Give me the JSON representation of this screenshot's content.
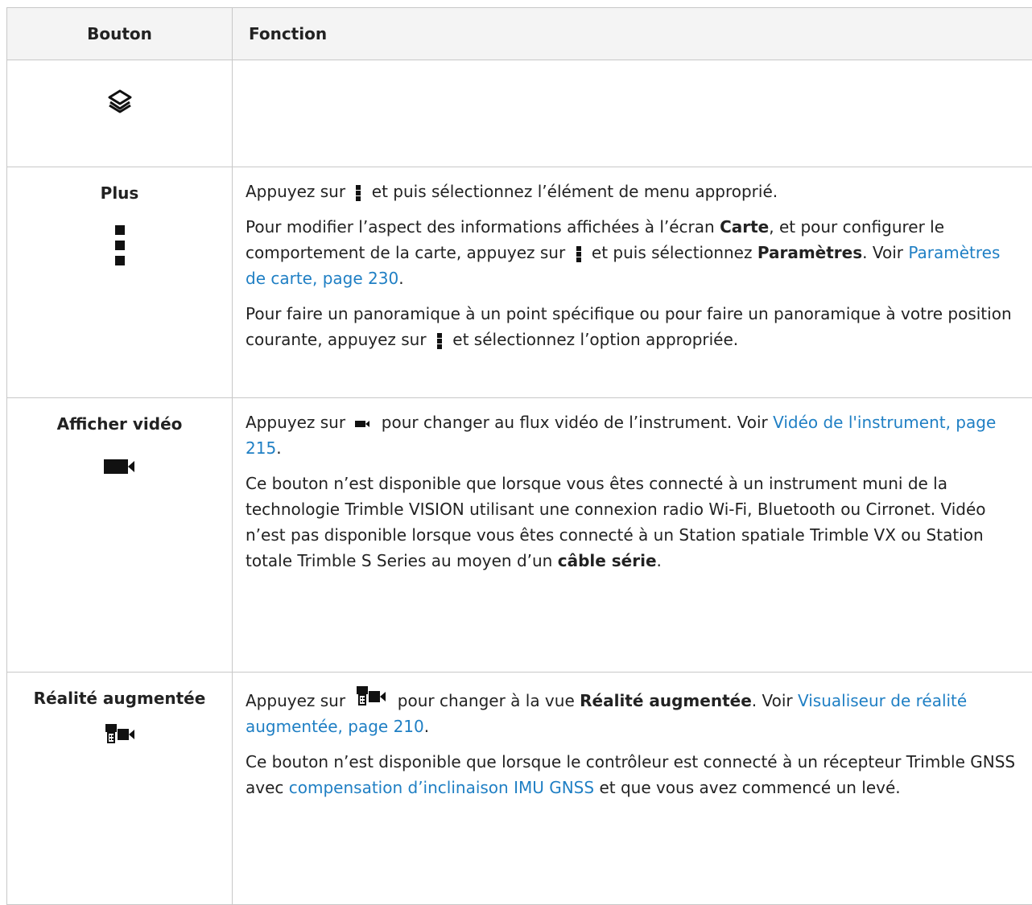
{
  "table": {
    "headers": {
      "button": "Bouton",
      "function": "Fonction"
    },
    "rows": {
      "layers": {
        "icon": "layers-icon"
      },
      "plus": {
        "label": "Plus",
        "icon": "more-vertical-icon",
        "p1_a": "Appuyez sur",
        "p1_b": "et puis sélectionnez l’élément de menu approprié.",
        "p2_a": "Pour modifier l’aspect des informations affichées à l’écran",
        "p2_b": "Carte",
        "p2_c": ", et pour configurer le comportement de la carte, appuyez sur",
        "p2_d": "et puis sélectionnez",
        "p2_e": "Paramètres",
        "p2_f": ". Voir",
        "p2_link": "Paramètres de carte, page 230",
        "p2_g": ".",
        "p3_a": "Pour faire un panoramique à un point spécifique ou pour faire un panoramique à votre position courante, appuyez sur",
        "p3_b": "et sélectionnez l’option appropriée."
      },
      "video": {
        "label": "Afficher vidéo",
        "icon": "video-camera-icon",
        "p1_a": "Appuyez sur",
        "p1_b": "pour changer au flux vidéo de l’instrument. Voir",
        "p1_link": "Vidéo de l'instrument, page 215",
        "p1_c": ".",
        "p2_a": "Ce bouton n’est disponible que lorsque vous êtes connecté à un instrument muni de la technologie Trimble VISION utilisant une connexion radio Wi-Fi, Bluetooth ou Cirronet. Vidéo n’est pas disponible lorsque vous êtes connecté à un Station spatiale Trimble VX ou Station totale Trimble S Series au moyen d’un",
        "p2_b": "câble série",
        "p2_c": "."
      },
      "ar": {
        "label": "Réalité augmentée",
        "icon": "augmented-reality-icon",
        "p1_a": "Appuyez sur",
        "p1_b": "pour changer à la vue",
        "p1_c": "Réalité augmentée",
        "p1_d": ". Voir",
        "p1_link": "Visualiseur de réalité augmentée, page 210",
        "p1_e": ".",
        "p2_a": "Ce bouton n’est disponible que lorsque le contrôleur est connecté à un récepteur Trimble GNSS avec",
        "p2_link": "compensation d’inclinaison IMU GNSS",
        "p2_b": "et que vous avez commencé un levé."
      }
    }
  },
  "colors": {
    "link": "#1f7fc4",
    "border": "#c8c8c8",
    "header_bg": "#f4f4f4"
  }
}
